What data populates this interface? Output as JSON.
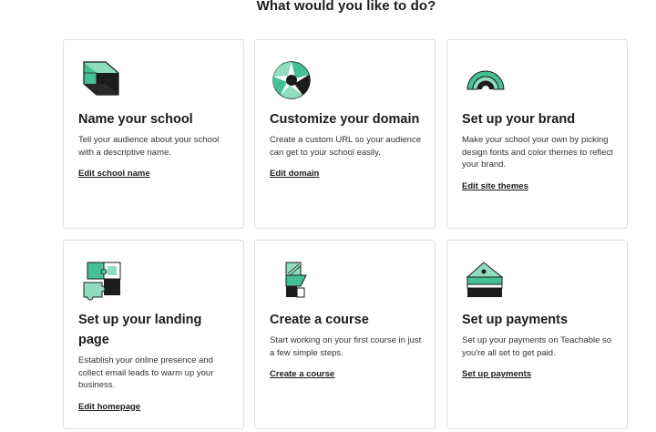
{
  "heading": "What would you like to do?",
  "colors": {
    "accent": "#45c095",
    "accent_light": "#8fdcbf",
    "dark": "#1c1c1c",
    "border": "#dfdfdf"
  },
  "cards": [
    {
      "icon": "cube-icon",
      "title": "Name your school",
      "description": "Tell your audience about your school with a descriptive name.",
      "link": "Edit school name"
    },
    {
      "icon": "camera-aperture-icon",
      "title": "Customize your domain",
      "description": "Create a custom URL so your audience can get to your school easily.",
      "link": "Edit domain"
    },
    {
      "icon": "rainbow-arc-icon",
      "title": "Set up your brand",
      "description": "Make your school your own by picking design fonts and color themes to reflect your brand.",
      "link": "Edit site themes"
    },
    {
      "icon": "puzzle-icon",
      "title": "Set up your landing page",
      "description": "Establish your online presence and collect email leads to warm up your business.",
      "link": "Edit homepage"
    },
    {
      "icon": "building-blocks-icon",
      "title": "Create a course",
      "description": "Start working on your first course in just a few simple steps.",
      "link": "Create a course"
    },
    {
      "icon": "cake-slice-icon",
      "title": "Set up payments",
      "description": "Set up your payments on Teachable so you're all set to get paid.",
      "link": "Set up payments"
    }
  ]
}
